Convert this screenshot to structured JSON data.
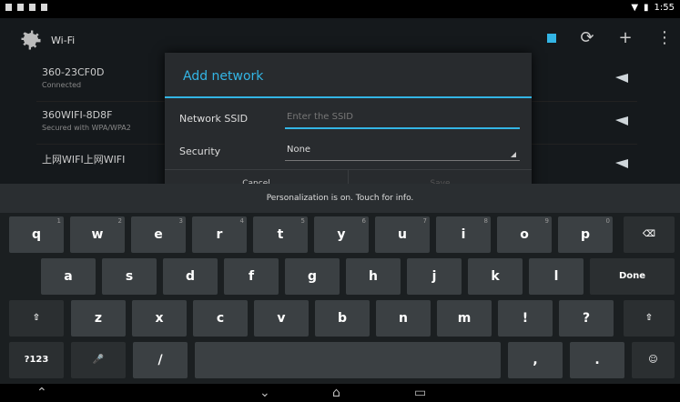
{
  "status_bar": {
    "time": "1:55"
  },
  "settings": {
    "title": "Wi-Fi",
    "networks": [
      {
        "name": "360-23CF0D",
        "subtitle": "Connected"
      },
      {
        "name": "360WIFI-8D8F",
        "subtitle": "Secured with WPA/WPA2"
      },
      {
        "name": "上网WIFI上网WIFI",
        "subtitle": ""
      }
    ]
  },
  "dialog": {
    "title": "Add network",
    "ssid_label": "Network SSID",
    "ssid_placeholder": "Enter the SSID",
    "security_label": "Security",
    "security_value": "None",
    "cancel_label": "Cancel",
    "save_label": "Save"
  },
  "keyboard": {
    "hint": "Personalization is on. Touch for info.",
    "row1": [
      {
        "k": "q",
        "a": "1"
      },
      {
        "k": "w",
        "a": "2"
      },
      {
        "k": "e",
        "a": "3"
      },
      {
        "k": "r",
        "a": "4"
      },
      {
        "k": "t",
        "a": "5"
      },
      {
        "k": "y",
        "a": "6"
      },
      {
        "k": "u",
        "a": "7"
      },
      {
        "k": "i",
        "a": "8"
      },
      {
        "k": "o",
        "a": "9"
      },
      {
        "k": "p",
        "a": "0"
      }
    ],
    "row2": [
      "a",
      "s",
      "d",
      "f",
      "g",
      "h",
      "j",
      "k",
      "l"
    ],
    "row3": [
      "z",
      "x",
      "c",
      "v",
      "b",
      "n",
      "m",
      "!",
      "?"
    ],
    "done_label": "Done",
    "symbols_label": "?123",
    "slash_label": "/",
    "comma_label": ",",
    "period_label": "."
  },
  "icons": [
    "settings-gear-icon",
    "refresh-icon",
    "add-icon",
    "overflow-menu-icon",
    "backspace-icon",
    "shift-icon",
    "mic-icon",
    "emoji-icon",
    "back-nav-icon",
    "home-nav-icon",
    "recents-nav-icon"
  ],
  "colors": {
    "accent": "#33b5e5",
    "dialog_bg": "#282b2e",
    "key_bg": "#3b4043"
  }
}
